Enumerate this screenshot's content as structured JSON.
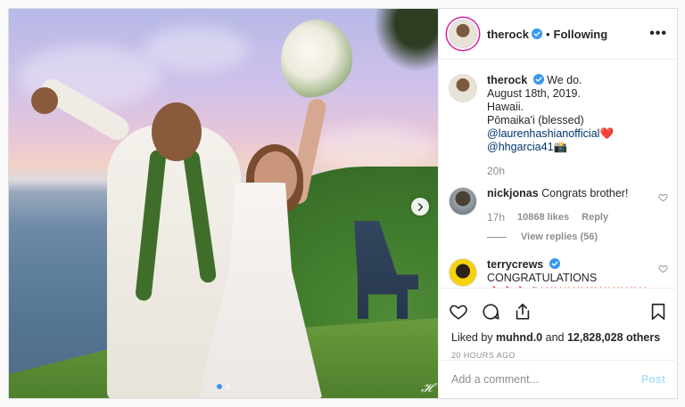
{
  "post": {
    "author": "therock",
    "follow_status": "Following",
    "separator": "•",
    "more_label": "•••"
  },
  "caption": {
    "username": "therock",
    "lines": [
      "We do.",
      "August 18th, 2019.",
      "Hawaii.",
      "Pōmaika'i (blessed)"
    ],
    "mention1": "@laurenhashianofficial",
    "mention1_emoji": "❤️",
    "mention2": "@hhgarcia41",
    "mention2_emoji": "📸",
    "time": "20h"
  },
  "comments": [
    {
      "username": "nickjonas",
      "text": "Congrats brother!",
      "time": "17h",
      "likes": "10868 likes",
      "reply_label": "Reply",
      "view_replies": "View replies (56)"
    },
    {
      "username": "terrycrews",
      "text": "CONGRATULATIONS",
      "emojis": "🔥🔥🔥👊🏾💥💥💥💥💥💥💥💥"
    }
  ],
  "likes_line": {
    "prefix": "Liked by",
    "user": "muhnd.0",
    "and": "and",
    "count": "12,828,028 others"
  },
  "posted_ago": "20 HOURS AGO",
  "add_comment": {
    "placeholder": "Add a comment...",
    "post_label": "Post"
  },
  "photo": {
    "watermark": "𝓗",
    "carousel_count": 2,
    "carousel_active": 0
  },
  "colors": {
    "verified": "#3897f0",
    "link": "#003569",
    "muted": "#8e8e8e",
    "post_disabled": "#b2dffc",
    "heart": "#ed4956"
  },
  "icons": [
    "verified-badge-icon",
    "more-options-icon",
    "heart-icon",
    "comment-icon",
    "share-icon",
    "bookmark-icon",
    "chevron-right-icon",
    "small-heart-icon"
  ]
}
